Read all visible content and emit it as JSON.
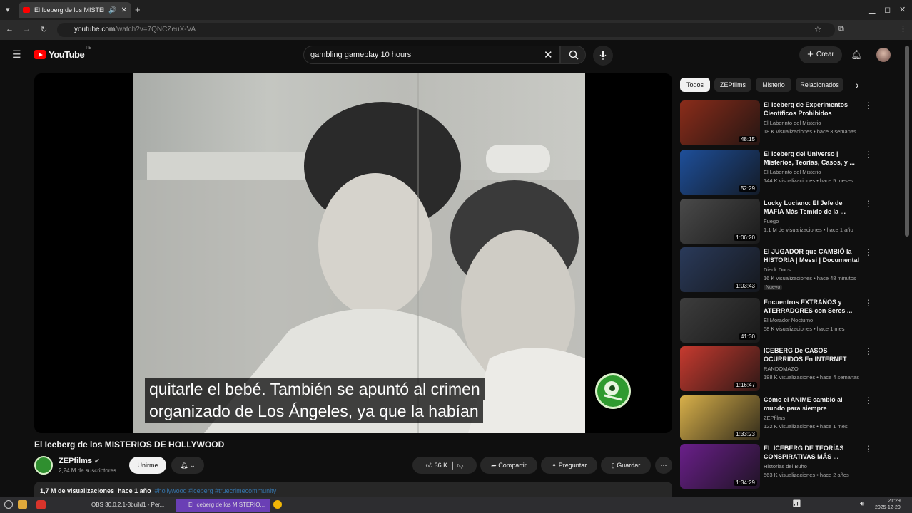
{
  "browser": {
    "tab_title": "El Iceberg de los MISTERIOS DE HOLLYWOOD - YouTube",
    "url_host": "youtube.com",
    "url_path": "/watch?v=7QNCZeuX-VA"
  },
  "masthead": {
    "logo_text": "YouTube",
    "country_code": "PE",
    "search_value": "gambling gameplay 10 hours",
    "create_label": "Crear"
  },
  "player": {
    "subtitle_line1": "quitarle el bebé. También se apuntó al crimen",
    "subtitle_line2": "organizado de Los Ángeles, ya que la habían"
  },
  "video": {
    "title": "El Iceberg de los MISTERIOS DE HOLLYWOOD",
    "channel": "ZEPfilms",
    "subscribers": "2,24 M de suscriptores",
    "join_label": "Unirme",
    "likes": "36 K",
    "share_label": "Compartir",
    "ask_label": "Preguntar",
    "save_label": "Guardar",
    "views": "1,7 M de visualizaciones",
    "age": "hace 1 año",
    "tags": "#hollywood #iceberg #truecrimecommunity"
  },
  "chips": [
    "Todos",
    "ZEPfilms",
    "Misterio",
    "Relacionados"
  ],
  "recommendations": [
    {
      "title": "El Iceberg de Experimentos Científicos Prohibidos",
      "channel": "El Laberinto del Misterio",
      "meta": "18 K visualizaciones • hace 3 semanas",
      "duration": "48:15",
      "color": "#8a2c1a"
    },
    {
      "title": "El Iceberg del Universo | Misterios, Teorías, Casos, y ...",
      "channel": "El Laberinto del Misterio",
      "meta": "144 K visualizaciones • hace 5 meses",
      "duration": "52:29",
      "color": "#1e4f9a"
    },
    {
      "title": "Lucky Luciano: El Jefe de MAFIA Más Temido de la ...",
      "channel": "Fuego",
      "meta": "1,1 M de visualizaciones • hace 1 año",
      "duration": "1:06:20",
      "color": "#4a4a4a"
    },
    {
      "title": "El JUGADOR que CAMBIÓ la HISTORIA | Messi | Documental",
      "channel": "Dieck Docs",
      "meta": "16 K visualizaciones • hace 48 minutos",
      "duration": "1:03:43",
      "color": "#2a3a5a",
      "badge": "Nuevo"
    },
    {
      "title": "Encuentros EXTRAÑOS y ATERRADORES con Seres ...",
      "channel": "El Morador Nocturno",
      "meta": "58 K visualizaciones • hace 1 mes",
      "duration": "41:30",
      "color": "#3d3d3d"
    },
    {
      "title": "ICEBERG De CASOS OCURRIDOS En INTERNET",
      "channel": "RANDOMAZO",
      "meta": "188 K visualizaciones • hace 4 semanas",
      "duration": "1:16:47",
      "color": "#c63a2f"
    },
    {
      "title": "Cómo el ANIME cambió al mundo para siempre",
      "channel": "ZEPfilms",
      "meta": "122 K visualizaciones • hace 1 mes",
      "duration": "1:33:23",
      "color": "#d8b04a"
    },
    {
      "title": "EL ICEBERG DE TEORÍAS CONSPIRATIVAS MÁS ...",
      "channel": "Historias del Buho",
      "meta": "563 K visualizaciones • hace 2 años",
      "duration": "1:34:29",
      "color": "#6a1f8a"
    }
  ],
  "taskbar": {
    "obs_label": "OBS 30.0.2.1-3build1 - Per...",
    "browser_label": "El Iceberg de los MISTERIO...",
    "time": "21:29",
    "date": "2025-12-20"
  }
}
